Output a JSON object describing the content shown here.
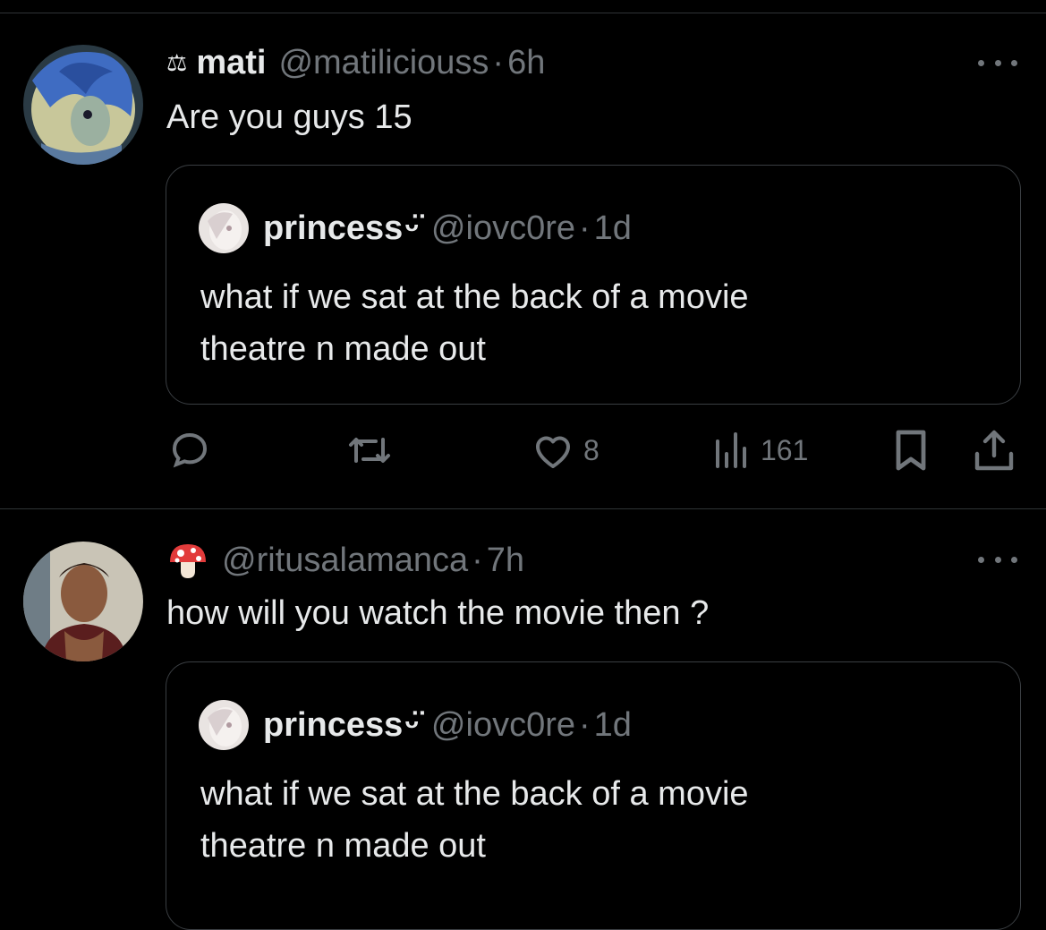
{
  "tweets": [
    {
      "name_prefix": "⚖",
      "name": "mati",
      "handle": "@matiliciouss",
      "separator": "·",
      "time": "6h",
      "text": "Are you guys 15",
      "quote": {
        "name": "princess",
        "name_suffix": "ᵕ̈",
        "handle": "@iovc0re",
        "separator": "·",
        "time": "1d",
        "text_line1": "what if we sat at the back of a movie",
        "text_line2": "theatre n made out"
      },
      "actions": {
        "replies": "",
        "reposts": "",
        "likes": "8",
        "views": "161"
      }
    },
    {
      "name_emoji": "mushroom-icon",
      "name": "",
      "handle": "@ritusalamanca",
      "separator": "·",
      "time": "7h",
      "text": "how will you watch the movie then ?",
      "quote": {
        "name": "princess",
        "name_suffix": "ᵕ̈",
        "handle": "@iovc0re",
        "separator": "·",
        "time": "1d",
        "text_line1": "what if we sat at the back of a movie",
        "text_line2": "theatre n made out"
      }
    }
  ],
  "colors": {
    "background": "#000000",
    "text": "#e7e9ea",
    "muted": "#71767b",
    "border": "#2f3336"
  }
}
